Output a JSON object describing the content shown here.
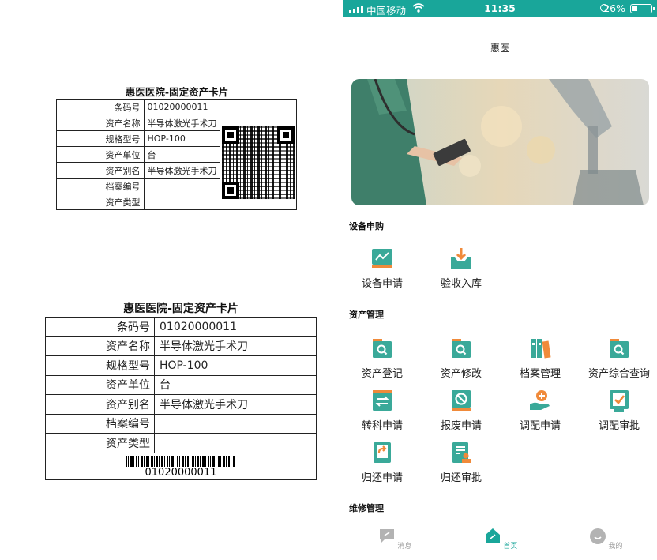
{
  "colors": {
    "accent": "#19a69a",
    "icon_teal": "#3aa999",
    "icon_orange": "#f08a3a",
    "tab_gray": "#b3b3b3"
  },
  "card_small": {
    "title": "惠医医院-固定资产卡片",
    "rows": [
      {
        "key": "条码号",
        "value": "01020000011"
      },
      {
        "key": "资产名称",
        "value": "半导体激光手术刀"
      },
      {
        "key": "规格型号",
        "value": "HOP-100"
      },
      {
        "key": "资产单位",
        "value": "台"
      },
      {
        "key": "资产别名",
        "value": "半导体激光手术刀"
      },
      {
        "key": "档案编号",
        "value": ""
      },
      {
        "key": "资产类型",
        "value": ""
      }
    ],
    "code_icon": "qr-code"
  },
  "card_large": {
    "title": "惠医医院-固定资产卡片",
    "rows": [
      {
        "key": "条码号",
        "value": "01020000011"
      },
      {
        "key": "资产名称",
        "value": "半导体激光手术刀"
      },
      {
        "key": "规格型号",
        "value": "HOP-100"
      },
      {
        "key": "资产单位",
        "value": "台"
      },
      {
        "key": "资产别名",
        "value": "半导体激光手术刀"
      },
      {
        "key": "档案编号",
        "value": ""
      },
      {
        "key": "资产类型",
        "value": ""
      }
    ],
    "barcode_number": "01020000011"
  },
  "phone": {
    "status": {
      "carrier": "中国移动",
      "time": "11:35",
      "battery": "26%",
      "wifi_icon": "wifi-icon",
      "lock_icon": "rotation-lock-icon"
    },
    "nav_title": "惠医",
    "banner": {
      "slides": 2,
      "active_slide": 0
    },
    "sections": [
      {
        "title": "设备申购",
        "items": [
          {
            "label": "设备申请",
            "icon": "chart-line-icon"
          },
          {
            "label": "验收入库",
            "icon": "inbox-download-icon"
          }
        ]
      },
      {
        "title": "资产管理",
        "items": [
          {
            "label": "资产登记",
            "icon": "folder-search-icon"
          },
          {
            "label": "资产修改",
            "icon": "folder-search-icon"
          },
          {
            "label": "档案管理",
            "icon": "binders-icon"
          },
          {
            "label": "资产综合查询",
            "icon": "folder-search-icon"
          },
          {
            "label": "转科申请",
            "icon": "transfer-arrows-icon"
          },
          {
            "label": "报废申请",
            "icon": "scrap-disc-icon"
          },
          {
            "label": "调配申请",
            "icon": "hand-plus-icon"
          },
          {
            "label": "调配审批",
            "icon": "checkbox-approve-icon"
          },
          {
            "label": "归还申请",
            "icon": "return-phone-icon"
          },
          {
            "label": "归还审批",
            "icon": "document-stamp-icon"
          }
        ]
      },
      {
        "title": "维修管理",
        "items": []
      }
    ],
    "tabs": [
      {
        "label": "消息",
        "icon": "message-icon",
        "active": false
      },
      {
        "label": "首页",
        "icon": "home-icon",
        "active": true
      },
      {
        "label": "我的",
        "icon": "profile-icon",
        "active": false
      }
    ]
  }
}
